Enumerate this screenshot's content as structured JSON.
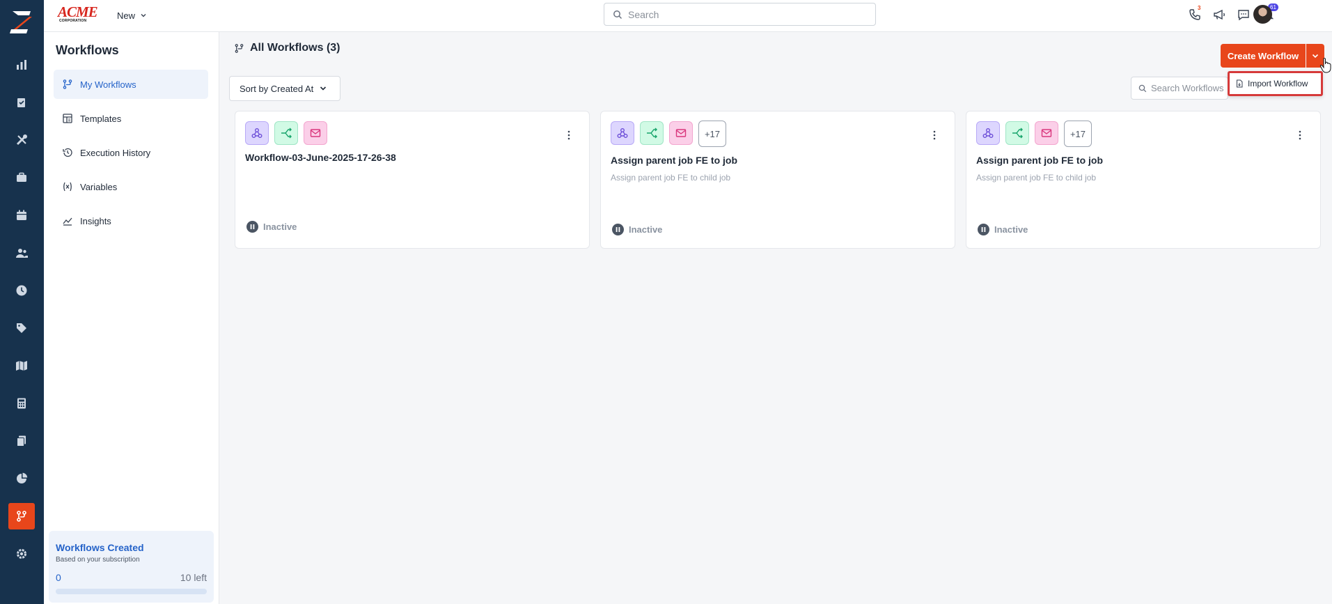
{
  "topbar": {
    "brand_main": "ACME",
    "brand_sub": "CORPORATION",
    "new_label": "New",
    "search_placeholder": "Search",
    "phone_badge": "3",
    "notifications_badge": "61"
  },
  "sidebar": {
    "title": "Workflows",
    "items": [
      {
        "label": "My Workflows",
        "icon": "workflow-icon"
      },
      {
        "label": "Templates",
        "icon": "templates-icon"
      },
      {
        "label": "Execution History",
        "icon": "history-icon"
      },
      {
        "label": "Variables",
        "icon": "variables-icon"
      },
      {
        "label": "Insights",
        "icon": "insights-icon"
      }
    ],
    "quota": {
      "title": "Workflows Created",
      "subtitle": "Based on your subscription",
      "used": "0",
      "left": "10 left",
      "used_fraction": 0
    }
  },
  "main": {
    "title": "All Workflows (3)",
    "sort_label": "Sort by Created At",
    "search_placeholder": "Search Workflows",
    "create_label": "Create Workflow",
    "import_label": "Import Workflow",
    "cards": [
      {
        "title": "Workflow-03-June-2025-17-26-38",
        "description": "",
        "extra": "",
        "status": "Inactive"
      },
      {
        "title": "Assign parent job FE to job",
        "description": "Assign parent job FE to child job",
        "extra": "+17",
        "status": "Inactive"
      },
      {
        "title": "Assign parent job FE to job",
        "description": "Assign parent job FE to child job",
        "extra": "+17",
        "status": "Inactive"
      }
    ]
  },
  "colors": {
    "accent": "#e8461b",
    "rail": "#17324d",
    "link": "#2563c9",
    "highlight": "#d63a3a"
  }
}
